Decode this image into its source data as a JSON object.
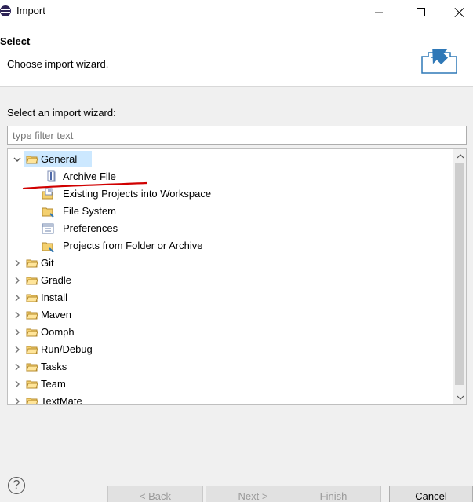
{
  "window": {
    "title": "Import",
    "controls": {
      "minimize_icon": "minimize-icon",
      "maximize_icon": "maximize-icon",
      "close_icon": "close-icon"
    }
  },
  "header": {
    "title": "Select",
    "subtitle": "Choose import wizard.",
    "banner_icon": "import-wizard-icon"
  },
  "wizard": {
    "label": "Select an import wizard:",
    "filter": {
      "value": "",
      "placeholder": "type filter text"
    },
    "tree": [
      {
        "label": "General",
        "expanded": true,
        "selected": true,
        "icon": "open-folder-icon",
        "children": [
          {
            "label": "Archive File",
            "icon": "archive-file-icon"
          },
          {
            "label": "Existing Projects into Workspace",
            "icon": "existing-projects-icon"
          },
          {
            "label": "File System",
            "icon": "file-system-icon"
          },
          {
            "label": "Preferences",
            "icon": "preferences-icon"
          },
          {
            "label": "Projects from Folder or Archive",
            "icon": "projects-folder-icon"
          }
        ]
      },
      {
        "label": "Git",
        "icon": "folder-icon"
      },
      {
        "label": "Gradle",
        "icon": "folder-icon"
      },
      {
        "label": "Install",
        "icon": "folder-icon"
      },
      {
        "label": "Maven",
        "icon": "folder-icon"
      },
      {
        "label": "Oomph",
        "icon": "folder-icon"
      },
      {
        "label": "Run/Debug",
        "icon": "folder-icon"
      },
      {
        "label": "Tasks",
        "icon": "folder-icon"
      },
      {
        "label": "Team",
        "icon": "folder-icon"
      },
      {
        "label": "TextMate",
        "icon": "folder-icon"
      }
    ]
  },
  "buttons": {
    "help": "?",
    "back": "< Back",
    "next": "Next >",
    "finish": "Finish",
    "cancel": "Cancel"
  },
  "colors": {
    "selection": "#cce8ff",
    "folder": "#f2c14e",
    "annotation": "#d00000",
    "disabled_text": "#9a9a9a"
  }
}
